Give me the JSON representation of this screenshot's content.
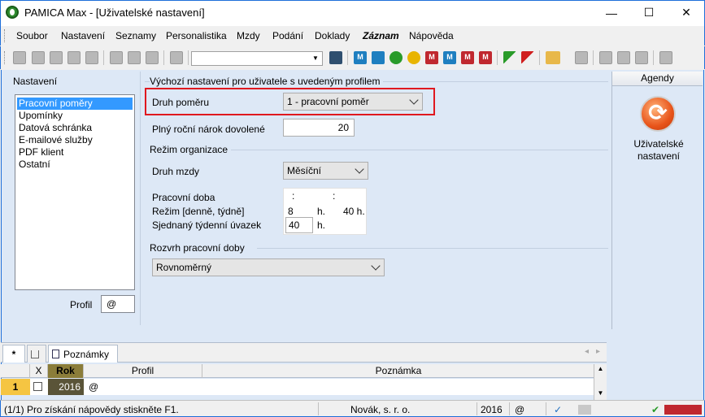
{
  "window": {
    "title": "PAMICA Max - [Uživatelské nastavení]",
    "minimize": "—",
    "maximize": "☐",
    "close": "✕"
  },
  "menu": [
    "Soubor",
    "Nastavení",
    "Seznamy",
    "Personalistika",
    "Mzdy",
    "Podání",
    "Doklady",
    "Záznam",
    "Nápověda"
  ],
  "toolbar": {
    "combo_value": "",
    "m_label": "M"
  },
  "left": {
    "heading": "Nastavení",
    "items": [
      "Pracovní poměry",
      "Upomínky",
      "Datová schránka",
      "E-mailové služby",
      "PDF klient",
      "Ostatní"
    ],
    "selected_index": 0,
    "profil_label": "Profil",
    "profil_value": "@"
  },
  "main": {
    "group_title": "Výchozí nastavení pro uživatele s uvedeným profilem",
    "druh_pomeru_label": "Druh poměru",
    "druh_pomeru_value": "1 - pracovní poměr",
    "narok_label": "Plný roční nárok dovolené",
    "narok_value": "20",
    "rezim_org_title": "Režim organizace",
    "druh_mzdy_label": "Druh mzdy",
    "druh_mzdy_value": "Měsíční",
    "pracovni_doba_label": "Pracovní doba",
    "time_sep": ":",
    "rezim_label": "Režim [denně, týdně]",
    "rezim_denne": "8",
    "rezim_unit": "h.",
    "rezim_tydne": "40 h.",
    "uvazek_label": "Sjednaný týdenní úvazek",
    "uvazek_value": "40",
    "uvazek_unit": "h.",
    "rozvrh_title": "Rozvrh pracovní doby",
    "rozvrh_value": "Rovnoměrný"
  },
  "agendy": {
    "header": "Agendy",
    "item_label_1": "Uživatelské",
    "item_label_2": "nastavení"
  },
  "bottom": {
    "tab_star": "*",
    "tab_notes": "Poznámky",
    "scroll_left": "◂",
    "scroll_right": "▸",
    "columns": {
      "x": "X",
      "rok": "Rok",
      "profil": "Profil",
      "poznamka": "Poznámka"
    },
    "row": {
      "num": "1",
      "rok": "2016",
      "profil": "@",
      "poznamka": ""
    }
  },
  "status": {
    "help": "(1/1) Pro získání nápovědy stiskněte F1.",
    "company": "Novák, s. r. o.",
    "year": "2016",
    "at": "@"
  }
}
